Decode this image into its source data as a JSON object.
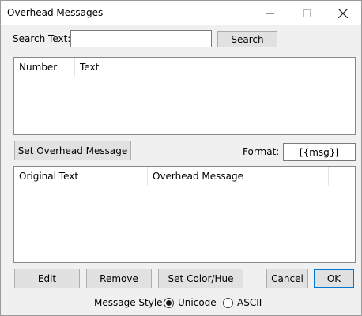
{
  "window": {
    "title": "Overhead Messages"
  },
  "search": {
    "label": "Search Text:",
    "value": "",
    "button_label": "Search"
  },
  "messages_list": {
    "columns": [
      "Number",
      "Text"
    ],
    "rows": []
  },
  "set_message_button_label": "Set Overhead Message",
  "format": {
    "label": "Format:",
    "value": "[{msg}]"
  },
  "overhead_list": {
    "columns": [
      "Original Text",
      "Overhead Message"
    ],
    "rows": []
  },
  "actions": {
    "edit": "Edit",
    "remove": "Remove",
    "set_color": "Set Color/Hue",
    "cancel": "Cancel",
    "ok": "OK"
  },
  "message_style": {
    "label": "Message Style:",
    "options": [
      "Unicode",
      "ASCII"
    ],
    "selected": "Unicode"
  }
}
